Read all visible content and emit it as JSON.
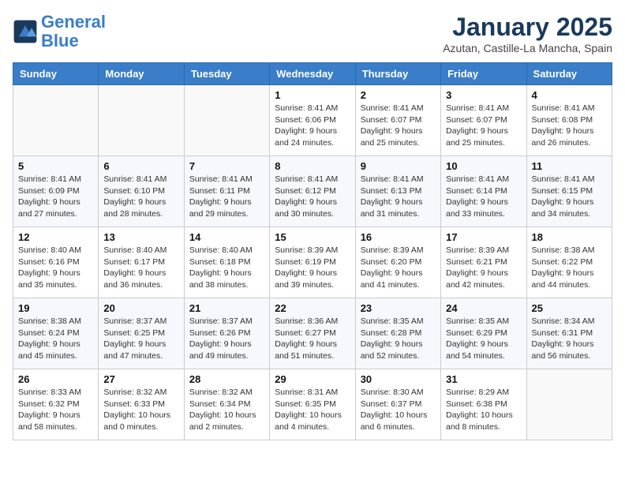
{
  "header": {
    "logo_line1": "General",
    "logo_line2": "Blue",
    "month_title": "January 2025",
    "location": "Azutan, Castille-La Mancha, Spain"
  },
  "weekdays": [
    "Sunday",
    "Monday",
    "Tuesday",
    "Wednesday",
    "Thursday",
    "Friday",
    "Saturday"
  ],
  "weeks": [
    [
      {
        "day": "",
        "sunrise": "",
        "sunset": "",
        "daylight": ""
      },
      {
        "day": "",
        "sunrise": "",
        "sunset": "",
        "daylight": ""
      },
      {
        "day": "",
        "sunrise": "",
        "sunset": "",
        "daylight": ""
      },
      {
        "day": "1",
        "sunrise": "Sunrise: 8:41 AM",
        "sunset": "Sunset: 6:06 PM",
        "daylight": "Daylight: 9 hours and 24 minutes."
      },
      {
        "day": "2",
        "sunrise": "Sunrise: 8:41 AM",
        "sunset": "Sunset: 6:07 PM",
        "daylight": "Daylight: 9 hours and 25 minutes."
      },
      {
        "day": "3",
        "sunrise": "Sunrise: 8:41 AM",
        "sunset": "Sunset: 6:07 PM",
        "daylight": "Daylight: 9 hours and 25 minutes."
      },
      {
        "day": "4",
        "sunrise": "Sunrise: 8:41 AM",
        "sunset": "Sunset: 6:08 PM",
        "daylight": "Daylight: 9 hours and 26 minutes."
      }
    ],
    [
      {
        "day": "5",
        "sunrise": "Sunrise: 8:41 AM",
        "sunset": "Sunset: 6:09 PM",
        "daylight": "Daylight: 9 hours and 27 minutes."
      },
      {
        "day": "6",
        "sunrise": "Sunrise: 8:41 AM",
        "sunset": "Sunset: 6:10 PM",
        "daylight": "Daylight: 9 hours and 28 minutes."
      },
      {
        "day": "7",
        "sunrise": "Sunrise: 8:41 AM",
        "sunset": "Sunset: 6:11 PM",
        "daylight": "Daylight: 9 hours and 29 minutes."
      },
      {
        "day": "8",
        "sunrise": "Sunrise: 8:41 AM",
        "sunset": "Sunset: 6:12 PM",
        "daylight": "Daylight: 9 hours and 30 minutes."
      },
      {
        "day": "9",
        "sunrise": "Sunrise: 8:41 AM",
        "sunset": "Sunset: 6:13 PM",
        "daylight": "Daylight: 9 hours and 31 minutes."
      },
      {
        "day": "10",
        "sunrise": "Sunrise: 8:41 AM",
        "sunset": "Sunset: 6:14 PM",
        "daylight": "Daylight: 9 hours and 33 minutes."
      },
      {
        "day": "11",
        "sunrise": "Sunrise: 8:41 AM",
        "sunset": "Sunset: 6:15 PM",
        "daylight": "Daylight: 9 hours and 34 minutes."
      }
    ],
    [
      {
        "day": "12",
        "sunrise": "Sunrise: 8:40 AM",
        "sunset": "Sunset: 6:16 PM",
        "daylight": "Daylight: 9 hours and 35 minutes."
      },
      {
        "day": "13",
        "sunrise": "Sunrise: 8:40 AM",
        "sunset": "Sunset: 6:17 PM",
        "daylight": "Daylight: 9 hours and 36 minutes."
      },
      {
        "day": "14",
        "sunrise": "Sunrise: 8:40 AM",
        "sunset": "Sunset: 6:18 PM",
        "daylight": "Daylight: 9 hours and 38 minutes."
      },
      {
        "day": "15",
        "sunrise": "Sunrise: 8:39 AM",
        "sunset": "Sunset: 6:19 PM",
        "daylight": "Daylight: 9 hours and 39 minutes."
      },
      {
        "day": "16",
        "sunrise": "Sunrise: 8:39 AM",
        "sunset": "Sunset: 6:20 PM",
        "daylight": "Daylight: 9 hours and 41 minutes."
      },
      {
        "day": "17",
        "sunrise": "Sunrise: 8:39 AM",
        "sunset": "Sunset: 6:21 PM",
        "daylight": "Daylight: 9 hours and 42 minutes."
      },
      {
        "day": "18",
        "sunrise": "Sunrise: 8:38 AM",
        "sunset": "Sunset: 6:22 PM",
        "daylight": "Daylight: 9 hours and 44 minutes."
      }
    ],
    [
      {
        "day": "19",
        "sunrise": "Sunrise: 8:38 AM",
        "sunset": "Sunset: 6:24 PM",
        "daylight": "Daylight: 9 hours and 45 minutes."
      },
      {
        "day": "20",
        "sunrise": "Sunrise: 8:37 AM",
        "sunset": "Sunset: 6:25 PM",
        "daylight": "Daylight: 9 hours and 47 minutes."
      },
      {
        "day": "21",
        "sunrise": "Sunrise: 8:37 AM",
        "sunset": "Sunset: 6:26 PM",
        "daylight": "Daylight: 9 hours and 49 minutes."
      },
      {
        "day": "22",
        "sunrise": "Sunrise: 8:36 AM",
        "sunset": "Sunset: 6:27 PM",
        "daylight": "Daylight: 9 hours and 51 minutes."
      },
      {
        "day": "23",
        "sunrise": "Sunrise: 8:35 AM",
        "sunset": "Sunset: 6:28 PM",
        "daylight": "Daylight: 9 hours and 52 minutes."
      },
      {
        "day": "24",
        "sunrise": "Sunrise: 8:35 AM",
        "sunset": "Sunset: 6:29 PM",
        "daylight": "Daylight: 9 hours and 54 minutes."
      },
      {
        "day": "25",
        "sunrise": "Sunrise: 8:34 AM",
        "sunset": "Sunset: 6:31 PM",
        "daylight": "Daylight: 9 hours and 56 minutes."
      }
    ],
    [
      {
        "day": "26",
        "sunrise": "Sunrise: 8:33 AM",
        "sunset": "Sunset: 6:32 PM",
        "daylight": "Daylight: 9 hours and 58 minutes."
      },
      {
        "day": "27",
        "sunrise": "Sunrise: 8:32 AM",
        "sunset": "Sunset: 6:33 PM",
        "daylight": "Daylight: 10 hours and 0 minutes."
      },
      {
        "day": "28",
        "sunrise": "Sunrise: 8:32 AM",
        "sunset": "Sunset: 6:34 PM",
        "daylight": "Daylight: 10 hours and 2 minutes."
      },
      {
        "day": "29",
        "sunrise": "Sunrise: 8:31 AM",
        "sunset": "Sunset: 6:35 PM",
        "daylight": "Daylight: 10 hours and 4 minutes."
      },
      {
        "day": "30",
        "sunrise": "Sunrise: 8:30 AM",
        "sunset": "Sunset: 6:37 PM",
        "daylight": "Daylight: 10 hours and 6 minutes."
      },
      {
        "day": "31",
        "sunrise": "Sunrise: 8:29 AM",
        "sunset": "Sunset: 6:38 PM",
        "daylight": "Daylight: 10 hours and 8 minutes."
      },
      {
        "day": "",
        "sunrise": "",
        "sunset": "",
        "daylight": ""
      }
    ]
  ]
}
